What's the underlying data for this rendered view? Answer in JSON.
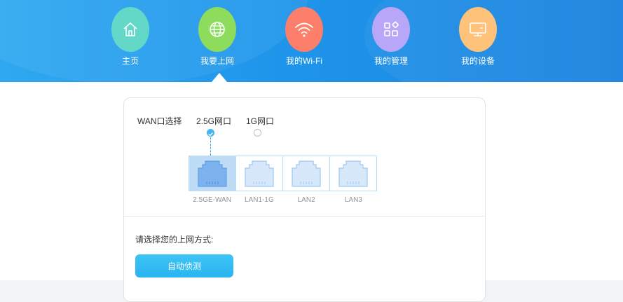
{
  "nav": {
    "items": [
      {
        "label": "主页",
        "icon": "home-icon",
        "color": "#63d8c9"
      },
      {
        "label": "我要上网",
        "icon": "globe-icon",
        "color": "#8edc5c"
      },
      {
        "label": "我的Wi-Fi",
        "icon": "wifi-icon",
        "color": "#fb7f6a"
      },
      {
        "label": "我的管理",
        "icon": "apps-icon",
        "color": "#b8a6f8"
      },
      {
        "label": "我的设备",
        "icon": "monitor-icon",
        "color": "#fec27a"
      }
    ],
    "active_index": 1
  },
  "wan": {
    "label": "WAN口选择",
    "options": [
      {
        "label": "2.5G网口",
        "selected": true
      },
      {
        "label": "1G网口",
        "selected": false
      }
    ]
  },
  "ports": [
    {
      "label": "2.5GE-WAN",
      "active": true
    },
    {
      "label": "LAN1-1G",
      "active": false
    },
    {
      "label": "LAN2",
      "active": false
    },
    {
      "label": "LAN3",
      "active": false
    }
  ],
  "method": {
    "label": "请选择您的上网方式:",
    "button": "自动侦测"
  },
  "colors": {
    "accent": "#29b4f1",
    "header": "#1e95ea"
  }
}
